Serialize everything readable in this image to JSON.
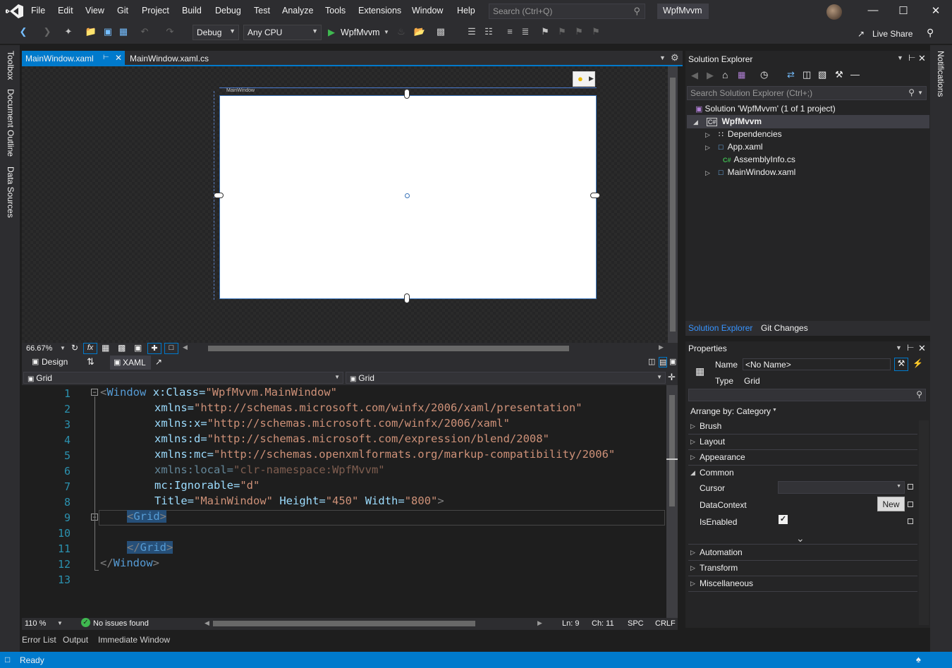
{
  "app": {
    "title": "WpfMvvm"
  },
  "menu": [
    "File",
    "Edit",
    "View",
    "Git",
    "Project",
    "Build",
    "Debug",
    "Test",
    "Analyze",
    "Tools",
    "Extensions",
    "Window",
    "Help"
  ],
  "search": {
    "placeholder": "Search (Ctrl+Q)"
  },
  "toolbar": {
    "config": "Debug",
    "platform": "Any CPU",
    "run_label": "WpfMvvm",
    "live_share": "Live Share"
  },
  "left_tabs": [
    "Toolbox",
    "Document Outline",
    "Data Sources"
  ],
  "right_tabs": [
    "Notifications"
  ],
  "doc_tabs": [
    {
      "label": "MainWindow.xaml",
      "active": true
    },
    {
      "label": "MainWindow.xaml.cs",
      "active": false
    }
  ],
  "designer": {
    "window_title": "MainWindow",
    "zoom": "66.67%",
    "design_label": "Design",
    "xaml_label": "XAML",
    "fx": "fx"
  },
  "nav": {
    "left": "Grid",
    "right": "Grid"
  },
  "editor": {
    "line_numbers": [
      "1",
      "2",
      "3",
      "4",
      "5",
      "6",
      "7",
      "8",
      "9",
      "10",
      "11",
      "12",
      "13"
    ],
    "lines": [
      [
        "<",
        "Window",
        " ",
        "x:Class",
        "=",
        "\"WpfMvvm.MainWindow\""
      ],
      [
        "xmlns",
        "=",
        "\"http://schemas.microsoft.com/winfx/2006/xaml/presentation\""
      ],
      [
        "xmlns:x",
        "=",
        "\"http://schemas.microsoft.com/winfx/2006/xaml\""
      ],
      [
        "xmlns:d",
        "=",
        "\"http://schemas.microsoft.com/expression/blend/2008\""
      ],
      [
        "xmlns:mc",
        "=",
        "\"http://schemas.openxmlformats.org/markup-compatibility/2006\""
      ],
      [
        "xmlns:local",
        "=",
        "\"clr-namespace:WpfMvvm\""
      ],
      [
        "mc:Ignorable",
        "=",
        "\"d\""
      ],
      [
        "Title",
        "=",
        "\"MainWindow\"",
        " ",
        "Height",
        "=",
        "\"450\"",
        " ",
        "Width",
        "=",
        "\"800\"",
        ">"
      ],
      [
        "<",
        "Grid",
        ">"
      ],
      [
        ""
      ],
      [
        "</",
        "Grid",
        ">"
      ],
      [
        "</",
        "Window",
        ">"
      ],
      [
        ""
      ]
    ],
    "zoom": "110 %",
    "issues": "No issues found",
    "ln": "Ln: 9",
    "ch": "Ch: 11",
    "spc": "SPC",
    "crlf": "CRLF"
  },
  "bottom_tabs": [
    "Error List",
    "Output",
    "Immediate Window"
  ],
  "status": {
    "text": "Ready"
  },
  "solution_explorer": {
    "title": "Solution Explorer",
    "search": "Search Solution Explorer (Ctrl+;)",
    "items": [
      "Solution 'WpfMvvm' (1 of 1 project)",
      "WpfMvvm",
      "Dependencies",
      "App.xaml",
      "AssemblyInfo.cs",
      "MainWindow.xaml"
    ],
    "tabs": [
      "Solution Explorer",
      "Git Changes"
    ]
  },
  "properties": {
    "title": "Properties",
    "name_label": "Name",
    "name_value": "<No Name>",
    "type_label": "Type",
    "type_value": "Grid",
    "arrange": "Arrange by: Category",
    "sections": [
      "Brush",
      "Layout",
      "Appearance",
      "Common",
      "Automation",
      "Transform",
      "Miscellaneous"
    ],
    "common_props": [
      "Cursor",
      "DataContext",
      "IsEnabled"
    ],
    "new_button": "New",
    "isenabled": true
  },
  "colors": {
    "accent": "#007acc",
    "chrome": "#2d2d30",
    "editor_bg": "#1e1e1e",
    "panel": "#252526"
  }
}
